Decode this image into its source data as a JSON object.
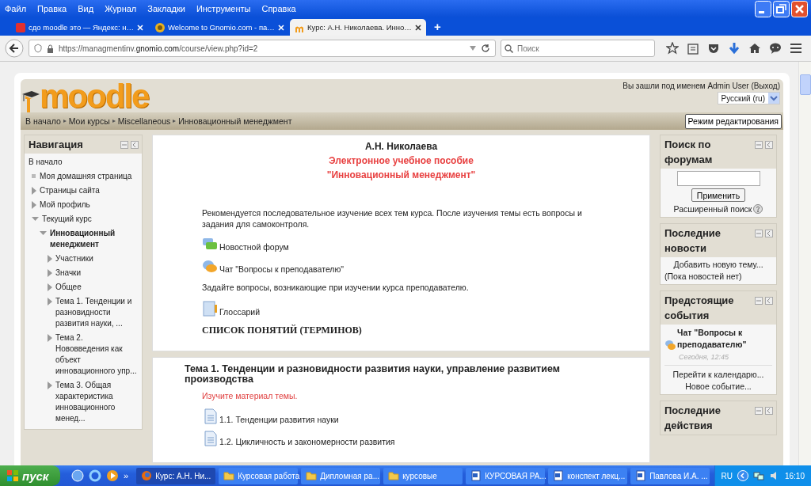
{
  "browser": {
    "menu": [
      "Файл",
      "Правка",
      "Вид",
      "Журнал",
      "Закладки",
      "Инструменты",
      "Справка"
    ],
    "tabs": [
      {
        "label": "сдо moodle это — Яндекс: н…",
        "kind": "yandex",
        "selected": false
      },
      {
        "label": "Welcome to Gnomio.com - па…",
        "kind": "gnomio",
        "selected": false
      },
      {
        "label": "Курс: А.Н. Николаева. Инно…",
        "kind": "moodle",
        "selected": true
      }
    ],
    "new_tab": "+",
    "url": "https://managmentinv.**gnomio.com**/course/view.php?id=2",
    "search_placeholder": "Поиск"
  },
  "moodle": {
    "logo": "moodle",
    "login_prefix": "Вы зашли под именем",
    "user": "Admin User",
    "logout": "(Выход)",
    "language": "Русский (ru)",
    "breadcrumb": [
      "В начало",
      "Мои курсы",
      "Miscellaneous",
      "Инновационный менеджмент"
    ],
    "edit_button": "Режим редактирования",
    "navigation": {
      "title": "Навигация",
      "items": [
        {
          "label": "В начало",
          "kind": "plain",
          "current": false
        },
        {
          "label": "Моя домашняя страница",
          "kind": "leaf",
          "current": false
        },
        {
          "label": "Страницы сайта",
          "kind": "branch",
          "expanded": false,
          "current": false
        },
        {
          "label": "Мой профиль",
          "kind": "branch",
          "expanded": false,
          "current": false
        },
        {
          "label": "Текущий курс",
          "kind": "branch",
          "expanded": true,
          "current": false,
          "children": [
            {
              "label": "Инновационный менеджмент",
              "kind": "branch",
              "expanded": true,
              "current": true,
              "children": [
                {
                  "label": "Участники",
                  "kind": "branch",
                  "expanded": false,
                  "current": false
                },
                {
                  "label": "Значки",
                  "kind": "branch",
                  "expanded": false,
                  "current": false
                },
                {
                  "label": "Общее",
                  "kind": "branch",
                  "expanded": false,
                  "current": false
                },
                {
                  "label": "Тема 1. Тенденции и разновидности развития науки, ...",
                  "kind": "branch",
                  "expanded": false,
                  "current": false
                },
                {
                  "label": "Тема 2. Нововведения как объект инновационного упр...",
                  "kind": "branch",
                  "expanded": false,
                  "current": false
                },
                {
                  "label": "Тема 3. Общая характеристика инновационного менед...",
                  "kind": "branch",
                  "expanded": false,
                  "current": false
                }
              ]
            }
          ]
        }
      ]
    },
    "intro_section": {
      "author": "А.Н. Николаева",
      "title_lines": [
        "Электронное учебное пособие",
        "\"Инновационный менеджмент\""
      ],
      "items": [
        {
          "kind": "text",
          "label": "Рекомендуется последовательное изучение всех тем курса. После изучения темы есть вопросы и задания для самоконтроля."
        },
        {
          "kind": "forum",
          "label": "Новостной форум"
        },
        {
          "kind": "chat",
          "label": "Чат \"Вопросы к преподавателю\""
        },
        {
          "kind": "text",
          "label": "Задайте вопросы, возникающие при изучении курса преподавателю."
        },
        {
          "kind": "glossary",
          "label": "Глоссарий"
        },
        {
          "kind": "terms",
          "label": "СПИСОК ПОНЯТИЙ (ТЕРМИНОВ)"
        }
      ]
    },
    "topic_section": {
      "heading": "Тема 1. Тенденции и разновидности развития науки, управление развитием производства",
      "note": "Изучите материал темы.",
      "items": [
        {
          "kind": "page",
          "label": "1.1. Тенденции развития науки"
        },
        {
          "kind": "page",
          "label": "1.2. Цикличность и закономерности развития"
        }
      ]
    },
    "blocks": [
      {
        "kind": "search",
        "title": "Поиск по форумам",
        "button": "Применить",
        "advanced": "Расширенный поиск"
      },
      {
        "kind": "news",
        "title": "Последние новости",
        "add": "Добавить новую тему...",
        "empty": "(Пока новостей нет)"
      },
      {
        "kind": "events",
        "title": "Предстоящие события",
        "event": "Чат \"Вопросы к преподавателю\"",
        "time": "Сегодня, 12:45",
        "links": [
          "Перейти к календарю...",
          "Новое событие..."
        ]
      },
      {
        "kind": "activity",
        "title": "Последние действия"
      }
    ]
  },
  "taskbar": {
    "start": "пуск",
    "more": "»",
    "tasks": [
      {
        "label": "Курс: А.Н. Ни...",
        "kind": "browser",
        "selected": true
      },
      {
        "label": "Курсовая работа",
        "kind": "folder",
        "selected": false
      },
      {
        "label": "Дипломная ра...",
        "kind": "folder",
        "selected": false
      },
      {
        "label": "курсовые",
        "kind": "folder",
        "selected": false
      },
      {
        "label": "КУРСОВАЯ РА...",
        "kind": "document",
        "selected": false
      },
      {
        "label": "конспект лекц...",
        "kind": "document",
        "selected": false
      },
      {
        "label": "Павлова И.А. ...",
        "kind": "document",
        "selected": false
      }
    ],
    "language": "RU",
    "time": "16:10"
  }
}
